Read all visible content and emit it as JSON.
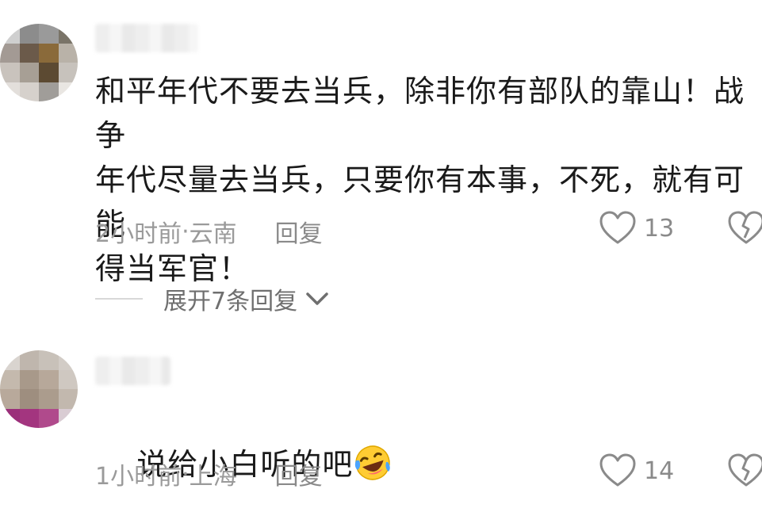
{
  "comments": [
    {
      "text": "和平年代不要去当兵，除非你有部队的靠山！战争\n年代尽量去当兵，只要你有本事，不死，就有可能\n得当军官！",
      "time": "2小时前",
      "location": "云南",
      "separator": " · ",
      "reply_label": "回复",
      "like_count": "13",
      "expand_label": "展开7条回复"
    },
    {
      "text": "说给小白听的吧",
      "emoji": "laughing-crying-emoji",
      "time": "1小时前",
      "location": "上海",
      "separator": " · ",
      "reply_label": "回复",
      "like_count": "14"
    }
  ],
  "icons": {
    "like": "heart-outline-icon",
    "dislike": "broken-heart-icon",
    "expand": "chevron-down-icon"
  },
  "colors": {
    "text": "#1a1a1a",
    "meta": "#9a9a9a",
    "icon": "#8a8a8a"
  }
}
